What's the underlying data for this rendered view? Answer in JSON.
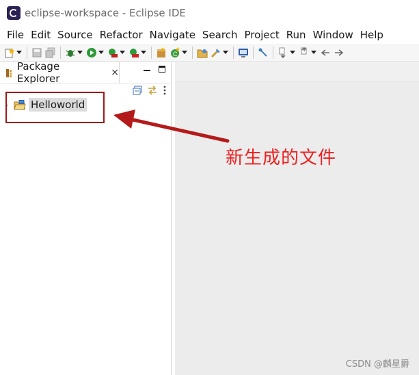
{
  "window": {
    "title": "eclipse-workspace - Eclipse IDE",
    "app_icon": "eclipse-logo-icon"
  },
  "menu": {
    "items": [
      "File",
      "Edit",
      "Source",
      "Refactor",
      "Navigate",
      "Search",
      "Project",
      "Run",
      "Window",
      "Help"
    ]
  },
  "toolbar": {
    "icons": [
      "new-icon",
      "save-icon",
      "save-all-icon",
      "debug-icon",
      "run-icon",
      "coverage-icon",
      "external-tools-icon",
      "new-java-package-icon",
      "new-java-class-icon",
      "open-type-icon",
      "search-icon",
      "console-icon",
      "next-annotation-icon",
      "previous-annotation-icon",
      "back-icon",
      "forward-icon"
    ]
  },
  "package_explorer": {
    "tab_label": "Package Explorer",
    "close_glyph": "×",
    "tools": [
      "collapse-all-icon",
      "link-with-editor-icon",
      "view-menu-icon"
    ],
    "projects": [
      {
        "name": "Helloworld",
        "icon": "java-project-folder-icon",
        "expanded": false
      }
    ]
  },
  "annotation": {
    "text": "新生成的文件",
    "color": "#ee1f1f"
  },
  "watermark": {
    "text": "CSDN @麟星爵"
  },
  "colors": {
    "highlight_box": "#a01818",
    "editor_bg": "#ececec",
    "toolbar_bg": "#f6f6f6"
  }
}
